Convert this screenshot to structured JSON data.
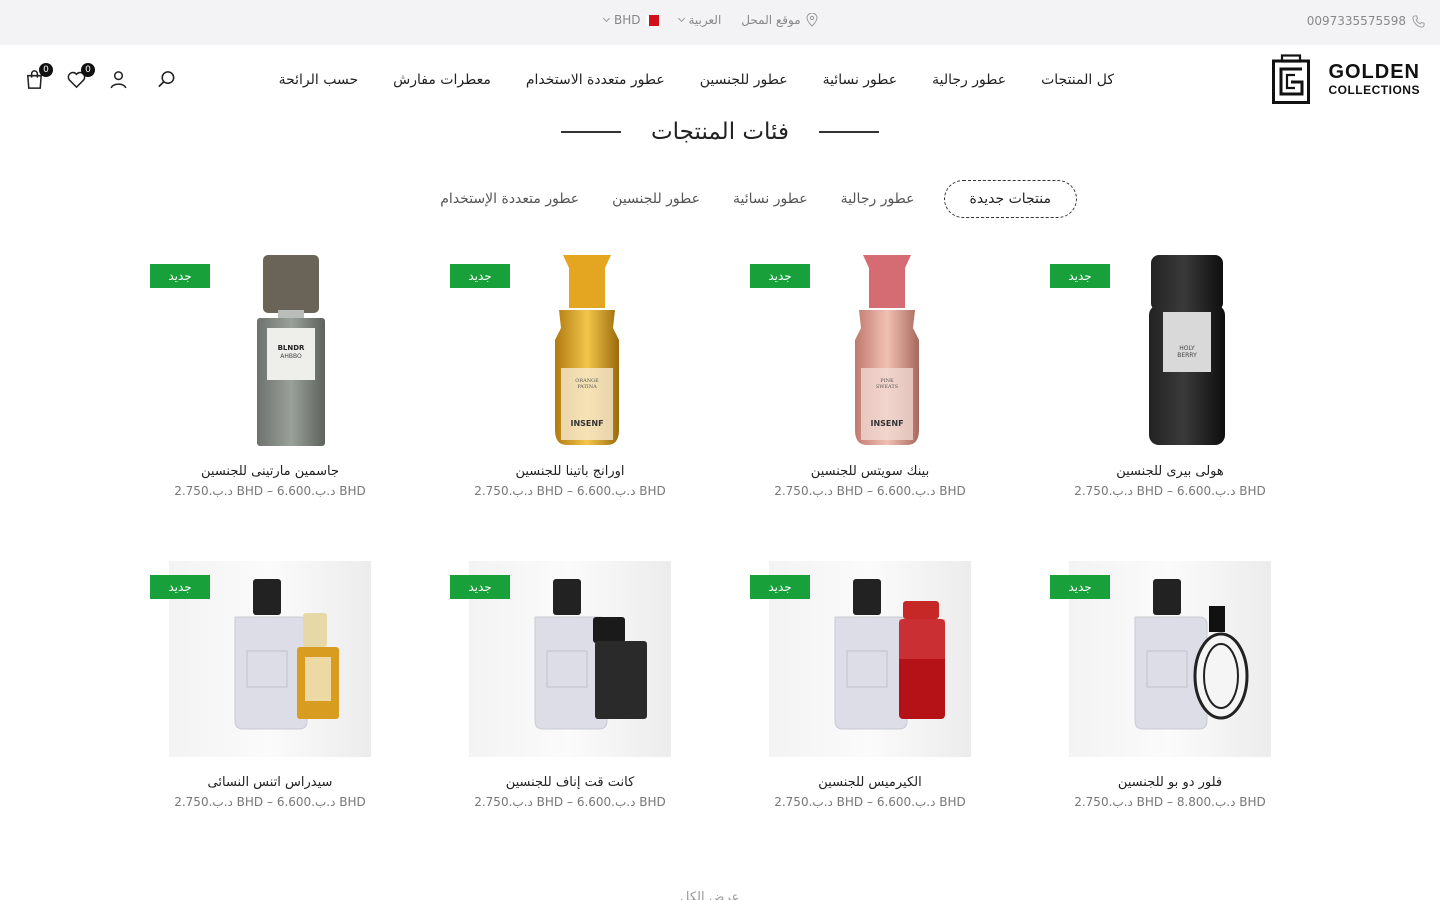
{
  "topbar": {
    "phone": "0097335575598",
    "store_location": "موقع المحل",
    "language": "العربية",
    "currency": "BHD"
  },
  "header": {
    "logo": {
      "line1": "GOLDEN",
      "line2": "COLLECTIONS"
    },
    "nav": [
      "كل المنتجات",
      "عطور رجالية",
      "عطور نسائية",
      "عطور للجنسين",
      "عطور متعددة الاستخدام",
      "معطرات مفارش",
      "حسب الرائحة"
    ],
    "wishlist_count": "0",
    "cart_count": "0"
  },
  "section": {
    "title": "فئات المنتجات",
    "tabs": [
      "منتجات جديدة",
      "عطور رجالية",
      "عطور نسائية",
      "عطور للجنسين",
      "عطور متعددة الإستخدام"
    ],
    "active_tab": 0
  },
  "badge_label": "جديد",
  "products": [
    {
      "name": "هولى بيرى للجنسين",
      "price": "د.ب.2.750 BHD – د.ب.6.600 BHD",
      "image": "black-bottle"
    },
    {
      "name": "بينك سويتس للجنسين",
      "price": "د.ب.2.750 BHD – د.ب.6.600 BHD",
      "image": "pink-bottle"
    },
    {
      "name": "اورانج باتينا للجنسين",
      "price": "د.ب.2.750 BHD – د.ب.6.600 BHD",
      "image": "orange-bottle"
    },
    {
      "name": "جاسمين مارتينى للجنسين",
      "price": "د.ب.2.750 BHD – د.ب.6.600 BHD",
      "image": "grey-bottle"
    },
    {
      "name": "فلور دو بو للجنسين",
      "price": "د.ب.2.750 BHD – د.ب.8.800 BHD",
      "image": "pair-oval"
    },
    {
      "name": "الكيرميس للجنسين",
      "price": "د.ب.2.750 BHD – د.ب.6.600 BHD",
      "image": "pair-red"
    },
    {
      "name": "كانت قت إناف للجنسين",
      "price": "د.ب.2.750 BHD – د.ب.6.600 BHD",
      "image": "pair-black"
    },
    {
      "name": "سيدراس اتنس النسائى",
      "price": "د.ب.2.750 BHD – د.ب.6.600 BHD",
      "image": "pair-gold"
    }
  ],
  "show_all": "عرض الكل",
  "colors": {
    "badge": "#18a03b",
    "topbar": "#f3f3f5",
    "text": "#222222"
  }
}
